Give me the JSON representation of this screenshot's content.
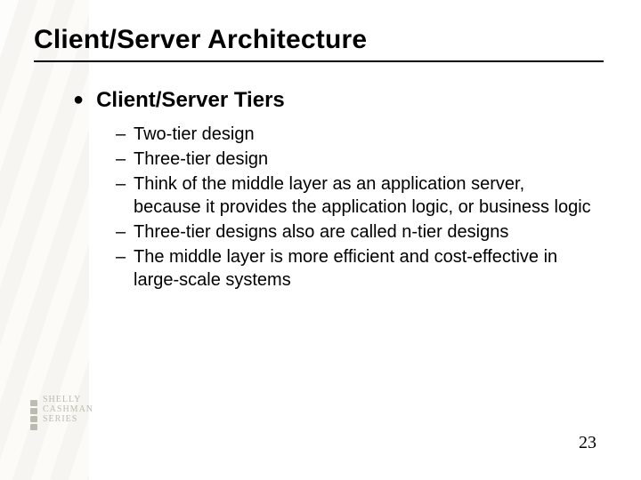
{
  "title": "Client/Server Architecture",
  "bullet": {
    "label": "Client/Server Tiers",
    "sub": [
      "Two-tier design",
      "Three-tier design",
      "Think of the middle layer as an application server, because it provides the application logic, or business logic",
      "Three-tier designs also are called n-tier designs",
      "The middle layer is more efficient and cost-effective in large-scale systems"
    ]
  },
  "page_number": "23",
  "logo": {
    "line1": "SHELLY",
    "line2": "CASHMAN",
    "line3": "SERIES"
  }
}
